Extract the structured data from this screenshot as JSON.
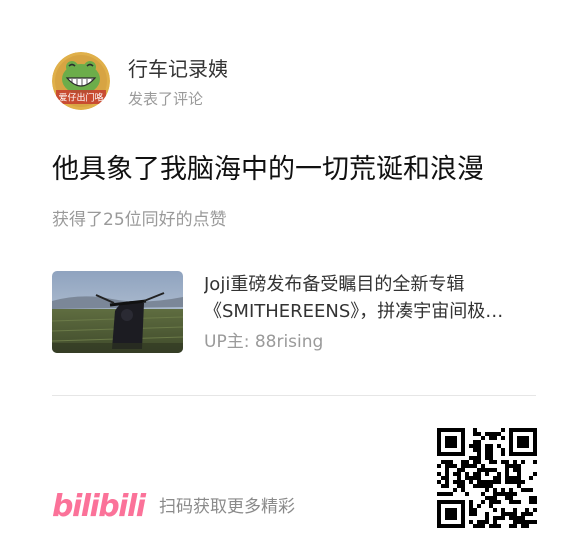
{
  "user": {
    "name": "行车记录姨",
    "action": "发表了评论",
    "avatar_caption": "爱仔出门咯"
  },
  "comment": {
    "text": "他具象了我脑海中的一切荒诞和浪漫",
    "likes_text": "获得了25位同好的点赞"
  },
  "video": {
    "title_line1": "Joji重磅发布备受瞩目的全新专辑",
    "title_line2": "《SMITHEREENS》，拼凑宇宙间极…",
    "up_label": "UP主:",
    "up_name": "88rising"
  },
  "footer": {
    "logo_text": "bilibili",
    "scan_text": "扫码获取更多精彩"
  },
  "colors": {
    "brand_pink": "#fb7299",
    "avatar_bg": "#e0b04a",
    "avatar_frog": "#6cad4a"
  }
}
